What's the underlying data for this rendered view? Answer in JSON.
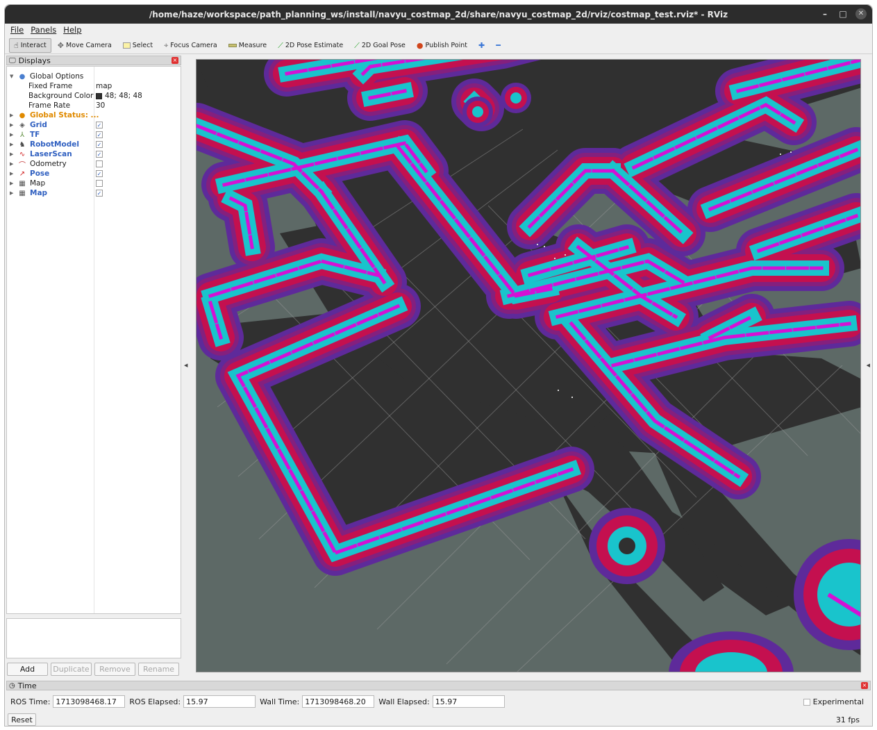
{
  "window": {
    "title": "/home/haze/workspace/path_planning_ws/install/navyu_costmap_2d/share/navyu_costmap_2d/rviz/costmap_test.rviz* - RViz",
    "minimize": "–",
    "maximize": "□",
    "close": "✕"
  },
  "menu": {
    "file": "File",
    "panels": "Panels",
    "help": "Help"
  },
  "toolbar": {
    "interact": "Interact",
    "move_camera": "Move Camera",
    "select": "Select",
    "focus_camera": "Focus Camera",
    "measure": "Measure",
    "pose_estimate": "2D Pose Estimate",
    "goal_pose": "2D Goal Pose",
    "publish_point": "Publish Point",
    "add_icon": "✚",
    "remove_icon": "━"
  },
  "displays": {
    "title": "Displays",
    "global_options": "Global Options",
    "fixed_frame_label": "Fixed Frame",
    "fixed_frame_value": "map",
    "background_color_label": "Background Color",
    "background_color_value": "48; 48; 48",
    "frame_rate_label": "Frame Rate",
    "frame_rate_value": "30",
    "global_status": "Global Status: ...",
    "items": [
      {
        "label": "Grid",
        "checked": true
      },
      {
        "label": "TF",
        "checked": true
      },
      {
        "label": "RobotModel",
        "checked": true
      },
      {
        "label": "LaserScan",
        "checked": true
      },
      {
        "label": "Odometry",
        "checked": false
      },
      {
        "label": "Pose",
        "checked": true
      },
      {
        "label": "Map",
        "checked": false
      },
      {
        "label": "Map",
        "checked": true
      }
    ],
    "check_mark": "✓",
    "buttons": {
      "add": "Add",
      "duplicate": "Duplicate",
      "remove": "Remove",
      "rename": "Rename"
    }
  },
  "colors": {
    "background": "#303030",
    "unknown": "#5d6966",
    "lethal": "#d411d4",
    "inscribed": "#19c4cc",
    "inflation_red": "#c4104f",
    "inflation_purple": "#5e2a9a",
    "grid": "#a0a0a0"
  },
  "time": {
    "title": "Time",
    "ros_time_label": "ROS Time:",
    "ros_time_value": "1713098468.17",
    "ros_elapsed_label": "ROS Elapsed:",
    "ros_elapsed_value": "15.97",
    "wall_time_label": "Wall Time:",
    "wall_time_value": "1713098468.20",
    "wall_elapsed_label": "Wall Elapsed:",
    "wall_elapsed_value": "15.97",
    "experimental": "Experimental",
    "reset": "Reset",
    "fps": "31 fps"
  }
}
